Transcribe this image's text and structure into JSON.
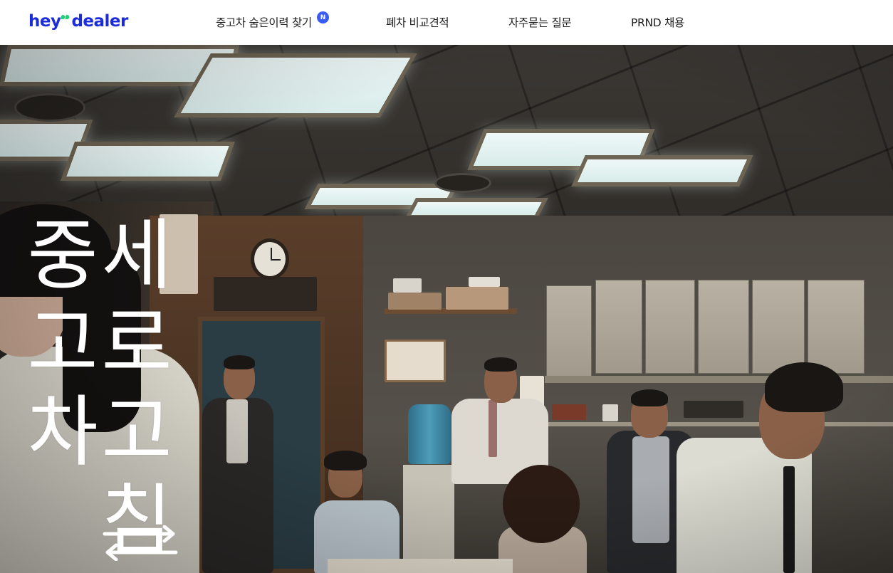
{
  "header": {
    "logo": {
      "part1": "hey",
      "part2": "dealer"
    },
    "nav": [
      {
        "label": "중고차 숨은이력 찾기",
        "badge": "N"
      },
      {
        "label": "폐차 비교견적"
      },
      {
        "label": "자주묻는 질문"
      },
      {
        "label": "PRND 채용"
      }
    ]
  },
  "hero": {
    "headline_col1": [
      "중",
      "고",
      "차"
    ],
    "headline_col2": [
      "세",
      "로",
      "고",
      "침"
    ],
    "colors": {
      "brand": "#1c2cdb",
      "logo_accent": "#1fcf73",
      "badge": "#3b5bf5",
      "headline": "#ffffff"
    }
  }
}
